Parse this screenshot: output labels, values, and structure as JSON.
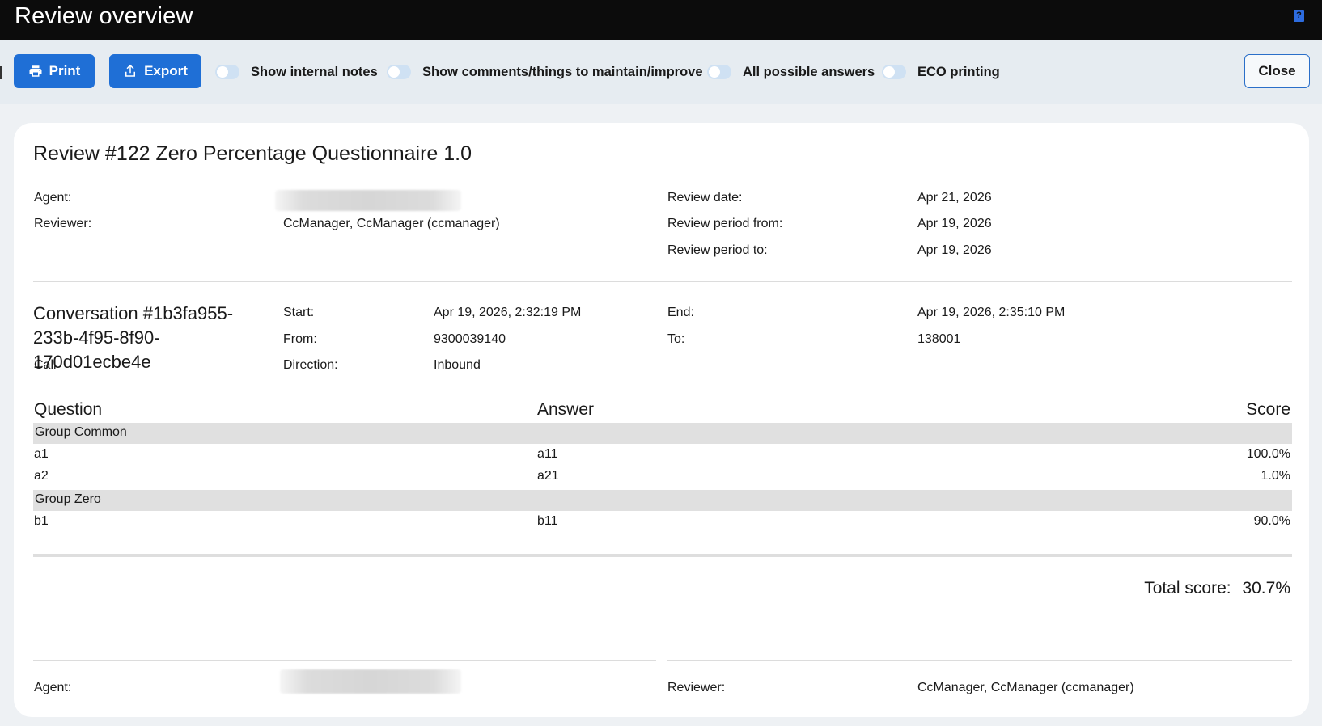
{
  "window": {
    "title": "Review overview",
    "help_icon": "help-book-icon"
  },
  "toolbar": {
    "print_label": "Print",
    "export_label": "Export",
    "toggles": [
      {
        "label": "Show internal notes",
        "on": false
      },
      {
        "label": "Show comments/things to maintain/improve",
        "on": false
      },
      {
        "label": "All possible answers",
        "on": false
      },
      {
        "label": "ECO printing",
        "on": false
      }
    ],
    "close_label": "Close"
  },
  "review": {
    "title": "Review #122 Zero Percentage Questionnaire 1.0",
    "agent_label": "Agent:",
    "reviewer_label": "Reviewer:",
    "reviewer_value": "CcManager, CcManager (ccmanager)",
    "review_date_label": "Review date:",
    "review_date_value": "Apr 21, 2026",
    "period_from_label": "Review period from:",
    "period_from_value": "Apr 19, 2026",
    "period_to_label": "Review period to:",
    "period_to_value": "Apr 19, 2026"
  },
  "conversation": {
    "title": "Conversation #1b3fa955-233b-4f95-8f90-170d01ecbe4e",
    "type": "Call",
    "start_label": "Start:",
    "start_value": "Apr 19, 2026, 2:32:19 PM",
    "from_label": "From:",
    "from_value": "9300039140",
    "direction_label": "Direction:",
    "direction_value": "Inbound",
    "end_label": "End:",
    "end_value": "Apr 19, 2026, 2:35:10 PM",
    "to_label": "To:",
    "to_value": "138001"
  },
  "table": {
    "headers": {
      "question": "Question",
      "answer": "Answer",
      "score": "Score"
    },
    "groups": [
      {
        "name": "Group Common",
        "rows": [
          {
            "question": "a1",
            "answer": "a11",
            "score": "100.0%"
          },
          {
            "question": "a2",
            "answer": "a21",
            "score": "1.0%"
          }
        ]
      },
      {
        "name": "Group Zero",
        "rows": [
          {
            "question": "b1",
            "answer": "b11",
            "score": "90.0%"
          }
        ]
      }
    ]
  },
  "total": {
    "label": "Total score:",
    "value": "30.7%"
  },
  "signatures": {
    "agent_label": "Agent:",
    "reviewer_label": "Reviewer:",
    "reviewer_value": "CcManager, CcManager (ccmanager)"
  }
}
